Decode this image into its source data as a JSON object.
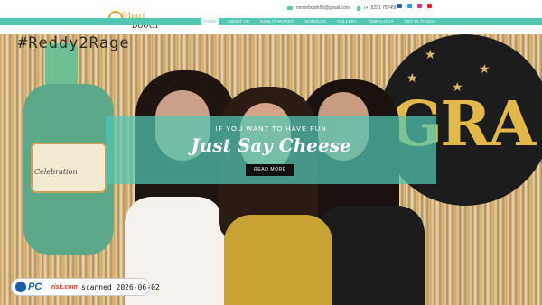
{
  "header": {
    "logo_top": "@hari",
    "logo_bottom": "booth",
    "email": "mirrorbooth56@gmail.com",
    "phone": "(+) 8291 757456",
    "social": [
      {
        "icon": "facebook-icon",
        "color": "#3b5998"
      },
      {
        "icon": "twitter-icon",
        "color": "#1da1f2"
      },
      {
        "icon": "instagram-icon",
        "color": "#c13584"
      },
      {
        "icon": "youtube-icon",
        "color": "#e62117"
      }
    ]
  },
  "nav": {
    "items": [
      "HOME",
      "ABOUT US",
      "HOW IT WORKS",
      "SERVICES",
      "GALLERY",
      "TEMPLATES",
      "GET IN TOUCH"
    ],
    "active_index": 0
  },
  "hero": {
    "hashtag": "#Reddy2Rage",
    "bottle_label": "Celebration",
    "balloon_letters": "GRA",
    "tagline": "IF YOU WANT TO HAVE FUN",
    "headline": "Just Say Cheese",
    "cta": "READ MORE"
  },
  "watermark": {
    "brand": "PC",
    "brand2": "risk.com",
    "stamp": "scanned 2026-06-02"
  },
  "colors": {
    "accent": "#52c8b4",
    "logo_gold": "#d8a93a",
    "button": "#111111"
  }
}
